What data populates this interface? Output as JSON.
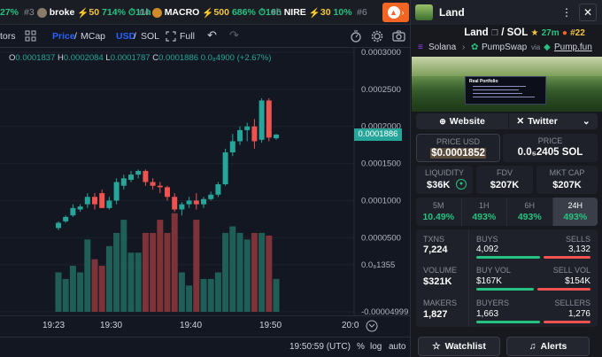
{
  "ticker": [
    {
      "rank": "",
      "sym": "",
      "pct": "27%",
      "pct_color": "g",
      "vol": "",
      "time": ""
    },
    {
      "rank": "#3",
      "sym": "broke",
      "pct": "714%",
      "vol": "50",
      "time": "11h"
    },
    {
      "rank": "#4",
      "sym": "MACRO",
      "pct": "686%",
      "vol": "500",
      "time": "16h"
    },
    {
      "rank": "#5",
      "sym": "NIRE",
      "pct": "10%",
      "vol": "30",
      "time": ""
    },
    {
      "rank": "#6",
      "sym": "",
      "pct": "",
      "vol": "",
      "time": ""
    }
  ],
  "toolbar": {
    "tors": "tors",
    "price": "Price",
    "mcap": "MCap",
    "usd": "USD",
    "sol": "SOL",
    "full": "Full"
  },
  "ohlc": {
    "o_label": "O",
    "o": "0.0001837",
    "h_label": "H",
    "h": "0.0002084",
    "l_label": "L",
    "l": "0.0001787",
    "c_label": "C",
    "c": "0.0001886",
    "chg": "0.0₈4900 (+2.67%)"
  },
  "yaxis": [
    {
      "label": "0.0003000",
      "v": 0.0003
    },
    {
      "label": "0.0002500",
      "v": 0.00025
    },
    {
      "label": "0.0002000",
      "v": 0.0002
    },
    {
      "label": "0.0001500",
      "v": 0.00015
    },
    {
      "label": "0.0001000",
      "v": 0.0001
    },
    {
      "label": "0.0000500",
      "v": 5e-05
    },
    {
      "label": "0.0₈1355",
      "v": 1.35e-05
    },
    {
      "label": "-0.00004999",
      "v": -4.999e-05
    }
  ],
  "last_price_tag": "0.0001886",
  "xaxis": [
    "19:23",
    "19:30",
    "19:40",
    "19:50",
    "20:0"
  ],
  "bottom": {
    "clock": "19:50:59 (UTC)",
    "pct": "%",
    "log": "log",
    "auto": "auto"
  },
  "chart_data": {
    "type": "candlestick",
    "ylim": [
      -4.999e-05,
      0.0003
    ],
    "candles": [
      {
        "o": 6.3e-05,
        "c": 7e-05,
        "h": 7.2e-05,
        "l": 6e-05,
        "v": 0.3
      },
      {
        "o": 7.2e-05,
        "c": 7.8e-05,
        "h": 8e-05,
        "l": 7e-05,
        "v": 0.25
      },
      {
        "o": 8e-05,
        "c": 9e-05,
        "h": 9.5e-05,
        "l": 7.8e-05,
        "v": 0.35
      },
      {
        "o": 8.8e-05,
        "c": 9.2e-05,
        "h": 9.5e-05,
        "l": 8.5e-05,
        "v": 0.3
      },
      {
        "o": 9.5e-05,
        "c": 0.000105,
        "h": 0.00011,
        "l": 9e-05,
        "v": 0.55
      },
      {
        "o": 0.000105,
        "c": 9.5e-05,
        "h": 0.00011,
        "l": 8.8e-05,
        "v": 0.4
      },
      {
        "o": 0.00011,
        "c": 9e-05,
        "h": 0.000115,
        "l": 9e-05,
        "v": 0.35
      },
      {
        "o": 9e-05,
        "c": 0.0001,
        "h": 0.000105,
        "l": 8.8e-05,
        "v": 0.5
      },
      {
        "o": 0.0001,
        "c": 0.000125,
        "h": 0.00013,
        "l": 9.5e-05,
        "v": 0.6
      },
      {
        "o": 0.00012,
        "c": 0.00013,
        "h": 0.000135,
        "l": 0.000115,
        "v": 0.7
      },
      {
        "o": 0.000128,
        "c": 0.000135,
        "h": 0.00014,
        "l": 0.000125,
        "v": 0.45
      },
      {
        "o": 0.000135,
        "c": 0.00014,
        "h": 0.000142,
        "l": 0.00013,
        "v": 0.45
      },
      {
        "o": 0.00014,
        "c": 0.000125,
        "h": 0.000142,
        "l": 0.00012,
        "v": 0.6
      },
      {
        "o": 0.000125,
        "c": 0.00012,
        "h": 0.00013,
        "l": 0.000115,
        "v": 0.6
      },
      {
        "o": 0.00012,
        "c": 0.000118,
        "h": 0.000125,
        "l": 0.00011,
        "v": 0.7
      },
      {
        "o": 0.000118,
        "c": 0.000105,
        "h": 0.00012,
        "l": 0.0001,
        "v": 0.6
      },
      {
        "o": 0.000105,
        "c": 8.8e-05,
        "h": 0.00011,
        "l": 8.5e-05,
        "v": 0.75
      },
      {
        "o": 8.8e-05,
        "c": 9.5e-05,
        "h": 9.8e-05,
        "l": 8e-05,
        "v": 0.3
      },
      {
        "o": 9.5e-05,
        "c": 0.0001,
        "h": 0.000105,
        "l": 9e-05,
        "v": 0.2
      },
      {
        "o": 0.0001,
        "c": 9.5e-05,
        "h": 0.00011,
        "l": 8.8e-05,
        "v": 0.7
      },
      {
        "o": 9.5e-05,
        "c": 0.000102,
        "h": 0.000105,
        "l": 9e-05,
        "v": 0.25
      },
      {
        "o": 0.000102,
        "c": 0.000108,
        "h": 0.000112,
        "l": 0.0001,
        "v": 0.25
      },
      {
        "o": 0.000108,
        "c": 0.000122,
        "h": 0.000125,
        "l": 0.000105,
        "v": 0.3
      },
      {
        "o": 0.000122,
        "c": 0.000165,
        "h": 0.00017,
        "l": 0.00012,
        "v": 0.6
      },
      {
        "o": 0.000165,
        "c": 0.00018,
        "h": 0.00019,
        "l": 0.00016,
        "v": 0.65
      },
      {
        "o": 0.00018,
        "c": 0.000195,
        "h": 0.0002,
        "l": 0.000175,
        "v": 0.6
      },
      {
        "o": 0.000195,
        "c": 0.0002,
        "h": 0.000205,
        "l": 0.00018,
        "v": 0.55
      },
      {
        "o": 0.0002,
        "c": 0.00018,
        "h": 0.00021,
        "l": 0.00017,
        "v": 0.6
      },
      {
        "o": 0.000182,
        "c": 0.000235,
        "h": 0.000238,
        "l": 0.000178,
        "v": 0.6
      },
      {
        "o": 0.000235,
        "c": 0.000185,
        "h": 0.000238,
        "l": 0.00018,
        "v": 0.58
      },
      {
        "o": 0.000184,
        "c": 0.000189,
        "h": 0.00019,
        "l": 0.000182,
        "v": 0.25
      }
    ]
  },
  "panel": {
    "title": "Land",
    "token": "Land",
    "pair": "/ SOL",
    "stars": "27m",
    "rank": "#22",
    "chain": "Solana",
    "dex": "PumpSwap",
    "via": "via",
    "launchpad": "Pump.fun",
    "banner_title": "Real Portfolio",
    "website": "Website",
    "twitter": "Twitter",
    "price_usd_label": "PRICE USD",
    "price_usd": "$0.0001852",
    "price_label": "PRICE",
    "price_sol": "0.0₅2405 SOL",
    "liq_label": "LIQUIDITY",
    "liq": "$36K",
    "fdv_label": "FDV",
    "fdv": "$207K",
    "mcap_label": "MKT CAP",
    "mcap": "$207K",
    "periods": [
      {
        "label": "5M",
        "val": "10.49%"
      },
      {
        "label": "1H",
        "val": "493%"
      },
      {
        "label": "6H",
        "val": "493%"
      },
      {
        "label": "24H",
        "val": "493%"
      }
    ],
    "txns_label": "TXNS",
    "txns": "7,224",
    "buys_label": "BUYS",
    "buys": "4,092",
    "buys_frac": 0.57,
    "sells_label": "SELLS",
    "sells": "3,132",
    "volume_label": "VOLUME",
    "volume": "$321K",
    "buyvol_label": "BUY VOL",
    "buyvol": "$167K",
    "buyvol_frac": 0.52,
    "sellvol_label": "SELL VOL",
    "sellvol": "$154K",
    "makers_label": "MAKERS",
    "makers": "1,827",
    "buyers_label": "BUYERS",
    "buyers": "1,663",
    "buyers_frac": 0.57,
    "sellers_label": "SELLERS",
    "sellers": "1,276",
    "watchlist": "Watchlist",
    "alerts": "Alerts"
  },
  "colors": {
    "up": "#26a69a",
    "down": "#ef5350",
    "accent": "#f26522",
    "bg": "#131722",
    "green": "#26c281",
    "red": "#ef5350"
  }
}
